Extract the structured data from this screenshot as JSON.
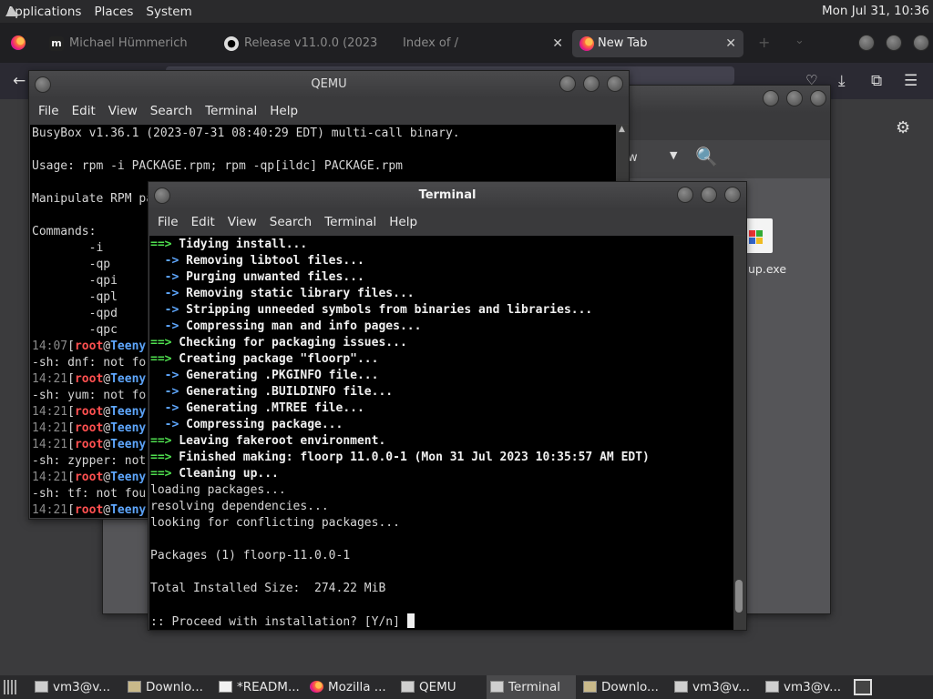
{
  "topbar": {
    "menus": [
      "Applications",
      "Places",
      "System"
    ],
    "clock": "Mon Jul 31, 10:36"
  },
  "browser": {
    "tabs": [
      {
        "label": "Michael Hümmerich",
        "icon": "m"
      },
      {
        "label": "Release v11.0.0 (2023",
        "icon": "github"
      },
      {
        "label": "Index of /",
        "icon": ""
      },
      {
        "label": "New Tab",
        "icon": "firefox"
      }
    ]
  },
  "qemu_window": {
    "title": "QEMU",
    "menu": [
      "File",
      "Edit",
      "View",
      "Search",
      "Terminal",
      "Help"
    ],
    "lines": [
      "BusyBox v1.36.1 (2023-07-31 08:40:29 EDT) multi-call binary.",
      "",
      "Usage: rpm -i PACKAGE.rpm; rpm -qp[ildc] PACKAGE.rpm",
      "",
      "Manipulate RPM packages",
      "",
      "Commands:",
      "        -i",
      "        -qp",
      "        -qpi",
      "        -qpl",
      "        -qpd",
      "        -qpc"
    ],
    "prompt_lines": [
      {
        "time": "14:07",
        "user": "root",
        "host": "Teeny"
      },
      {
        "text": "-sh: dnf: not fo"
      },
      {
        "time": "14:21",
        "user": "root",
        "host": "Teeny"
      },
      {
        "text": "-sh: yum: not fo"
      },
      {
        "time": "14:21",
        "user": "root",
        "host": "Teeny"
      },
      {
        "time": "14:21",
        "user": "root",
        "host": "Teeny"
      },
      {
        "time": "14:21",
        "user": "root",
        "host": "Teeny"
      },
      {
        "text": "-sh: zypper: not"
      },
      {
        "time": "14:21",
        "user": "root",
        "host": "Teeny"
      },
      {
        "text": "-sh: tf: not fou"
      },
      {
        "time": "14:21",
        "user": "root",
        "host": "Teeny"
      }
    ]
  },
  "file_manager": {
    "view_label": "ew",
    "file_label": "up.exe"
  },
  "terminal_window": {
    "title": "Terminal",
    "menu": [
      "File",
      "Edit",
      "View",
      "Search",
      "Terminal",
      "Help"
    ],
    "lines": [
      {
        "p": "==>",
        "t": " Tidying install...",
        "k": "main"
      },
      {
        "p": "  ->",
        "t": " Removing libtool files...",
        "k": "sub"
      },
      {
        "p": "  ->",
        "t": " Purging unwanted files...",
        "k": "sub"
      },
      {
        "p": "  ->",
        "t": " Removing static library files...",
        "k": "sub"
      },
      {
        "p": "  ->",
        "t": " Stripping unneeded symbols from binaries and libraries...",
        "k": "sub"
      },
      {
        "p": "  ->",
        "t": " Compressing man and info pages...",
        "k": "sub"
      },
      {
        "p": "==>",
        "t": " Checking for packaging issues...",
        "k": "main"
      },
      {
        "p": "==>",
        "t": " Creating package \"floorp\"...",
        "k": "main"
      },
      {
        "p": "  ->",
        "t": " Generating .PKGINFO file...",
        "k": "sub"
      },
      {
        "p": "  ->",
        "t": " Generating .BUILDINFO file...",
        "k": "sub"
      },
      {
        "p": "  ->",
        "t": " Generating .MTREE file...",
        "k": "sub"
      },
      {
        "p": "  ->",
        "t": " Compressing package...",
        "k": "sub"
      },
      {
        "p": "==>",
        "t": " Leaving fakeroot environment.",
        "k": "main"
      },
      {
        "p": "==>",
        "t": " Finished making: floorp 11.0.0-1 (Mon 31 Jul 2023 10:35:57 AM EDT)",
        "k": "main"
      },
      {
        "p": "==>",
        "t": " Cleaning up...",
        "k": "main"
      },
      {
        "p": "",
        "t": "loading packages...",
        "k": "plain"
      },
      {
        "p": "",
        "t": "resolving dependencies...",
        "k": "plain"
      },
      {
        "p": "",
        "t": "looking for conflicting packages...",
        "k": "plain"
      },
      {
        "p": "",
        "t": "",
        "k": "plain"
      },
      {
        "p": "",
        "t": "Packages (1) floorp-11.0.0-1",
        "k": "plain"
      },
      {
        "p": "",
        "t": "",
        "k": "plain"
      },
      {
        "p": "",
        "t": "Total Installed Size:  274.22 MiB",
        "k": "plain"
      },
      {
        "p": "",
        "t": "",
        "k": "plain"
      }
    ],
    "prompt": ":: Proceed with installation? [Y/n] "
  },
  "taskbar": {
    "items": [
      {
        "label": "vm3@v...",
        "icon": "terminal-icon"
      },
      {
        "label": "Downlo...",
        "icon": "folder-icon"
      },
      {
        "label": "*READM...",
        "icon": "text-editor-icon"
      },
      {
        "label": "Mozilla ...",
        "icon": "firefox-icon"
      },
      {
        "label": "QEMU",
        "icon": "terminal-icon"
      },
      {
        "label": "Terminal",
        "icon": "terminal-icon"
      },
      {
        "label": "Downlo...",
        "icon": "folder-icon"
      },
      {
        "label": "vm3@v...",
        "icon": "terminal-icon"
      },
      {
        "label": "vm3@v...",
        "icon": "terminal-icon"
      }
    ],
    "active_index": 5
  }
}
